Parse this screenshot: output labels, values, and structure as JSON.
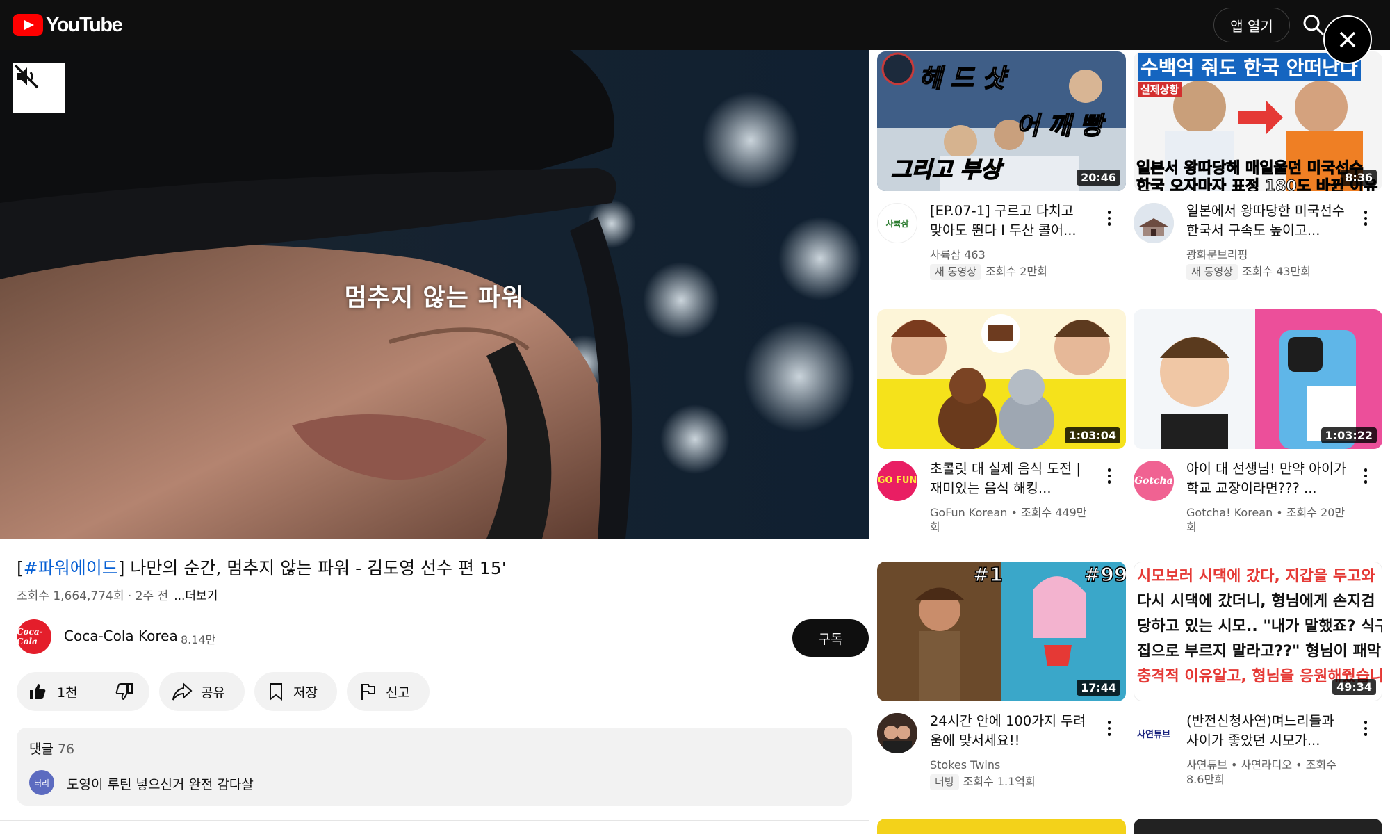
{
  "header": {
    "logo_text": "YouTube",
    "open_app_label": "앱 열기"
  },
  "player": {
    "caption": "멈추지 않는 파워"
  },
  "video": {
    "title_hashtag": "#파워에이드",
    "title_rest": "] 나만의 순간, 멈추지 않는 파워 - 김도영 선수 편 15'",
    "title_open_bracket": "[",
    "stats": "조회수 1,664,774회 · 2주 전",
    "more_label": "...더보기"
  },
  "channel": {
    "avatar_text": "Coca-Cola",
    "name": "Coca-Cola Korea",
    "subscribers": "8.14만",
    "subscribe_label": "구독"
  },
  "actions": {
    "like_count": "1천",
    "share_label": "공유",
    "save_label": "저장",
    "report_label": "신고"
  },
  "comments": {
    "label": "댓글",
    "count": "76",
    "avatar_text": "터리",
    "top_comment": "도영이 루틴 넣으신거 완전 감다살"
  },
  "sidebar": {
    "videos": [
      {
        "thumb_text": [
          "헤 드 샷",
          "어 깨 빵",
          "그리고 부상"
        ],
        "duration": "20:46",
        "avatar_text": "사륙삼",
        "title": "[EP.07-1] 구르고 다치고 맞아도 뛴다 I 두산 콜어...",
        "channel": "사륙삼 463",
        "badge": "새 동영상",
        "views": "조회수 2만회"
      },
      {
        "thumb_text": [
          "수백억 줘도 한국 안떠난다",
          "실제상황",
          "일본서 왕따당해 매일울던 미국선수",
          "한국 오자마자 표정 180도 바뀐 이유"
        ],
        "duration": "8:36",
        "avatar_text": "",
        "title": "일본에서 왕따당한 미국선수 한국서 구속도 높이고...",
        "channel": "광화문브리핑",
        "badge": "새 동영상",
        "views": "조회수 43만회"
      },
      {
        "duration": "1:03:04",
        "avatar_text": "GO FUN",
        "title": "초콜릿 대 실제 음식 도전 | 재미있는 음식 해킹...",
        "meta": "GoFun Korean • 조회수 449만회"
      },
      {
        "duration": "1:03:22",
        "avatar_text": "Gotcha",
        "title": "아이 대 선생님! 만약 아이가 학교 교장이라면??? ...",
        "meta": "Gotcha! Korean • 조회수 20만회"
      },
      {
        "thumb_text": [
          "#1",
          "#99"
        ],
        "duration": "17:44",
        "avatar_text": "",
        "title": "24시간 안에 100가지 두려움에 맞서세요!!",
        "channel": "Stokes Twins",
        "badge": "더빙",
        "views": "조회수 1.1억회"
      },
      {
        "thumb_text": [
          "시모보러 시댁에 갔다, 지갑을 두고와",
          "다시 시댁에 갔더니, 형님에게 손지검",
          "당하고 있는 시모.. \"내가 말했죠? 식구들",
          "집으로 부르지 말라고??\" 형님이 패악질 한",
          "충격적 이유알고, 형님을 응원해줬습니다"
        ],
        "duration": "49:34",
        "avatar_text": "사연튜브",
        "title": "(반전신청사연)며느리들과 사이가 좋았던 시모가...",
        "meta": "사연튜브 • 사연라디오 • 조회수 8.6만회"
      }
    ]
  },
  "colors": {
    "brand_red": "#ff0000",
    "link_blue": "#065fd4",
    "top_bar": "#0f0f0f"
  }
}
